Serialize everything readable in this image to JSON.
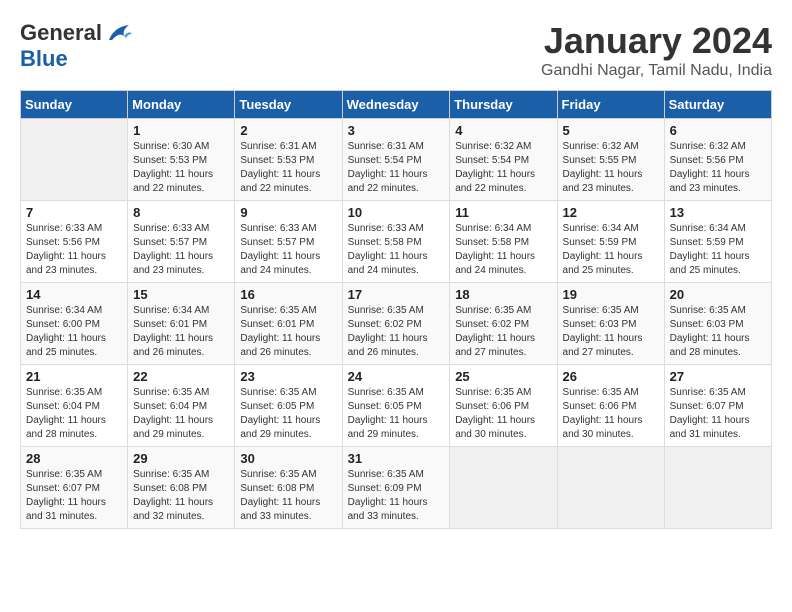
{
  "header": {
    "logo_general": "General",
    "logo_blue": "Blue",
    "title": "January 2024",
    "subtitle": "Gandhi Nagar, Tamil Nadu, India"
  },
  "calendar": {
    "days_of_week": [
      "Sunday",
      "Monday",
      "Tuesday",
      "Wednesday",
      "Thursday",
      "Friday",
      "Saturday"
    ],
    "weeks": [
      [
        {
          "day": "",
          "sunrise": "",
          "sunset": "",
          "daylight": ""
        },
        {
          "day": "1",
          "sunrise": "Sunrise: 6:30 AM",
          "sunset": "Sunset: 5:53 PM",
          "daylight": "Daylight: 11 hours and 22 minutes."
        },
        {
          "day": "2",
          "sunrise": "Sunrise: 6:31 AM",
          "sunset": "Sunset: 5:53 PM",
          "daylight": "Daylight: 11 hours and 22 minutes."
        },
        {
          "day": "3",
          "sunrise": "Sunrise: 6:31 AM",
          "sunset": "Sunset: 5:54 PM",
          "daylight": "Daylight: 11 hours and 22 minutes."
        },
        {
          "day": "4",
          "sunrise": "Sunrise: 6:32 AM",
          "sunset": "Sunset: 5:54 PM",
          "daylight": "Daylight: 11 hours and 22 minutes."
        },
        {
          "day": "5",
          "sunrise": "Sunrise: 6:32 AM",
          "sunset": "Sunset: 5:55 PM",
          "daylight": "Daylight: 11 hours and 23 minutes."
        },
        {
          "day": "6",
          "sunrise": "Sunrise: 6:32 AM",
          "sunset": "Sunset: 5:56 PM",
          "daylight": "Daylight: 11 hours and 23 minutes."
        }
      ],
      [
        {
          "day": "7",
          "sunrise": "Sunrise: 6:33 AM",
          "sunset": "Sunset: 5:56 PM",
          "daylight": "Daylight: 11 hours and 23 minutes."
        },
        {
          "day": "8",
          "sunrise": "Sunrise: 6:33 AM",
          "sunset": "Sunset: 5:57 PM",
          "daylight": "Daylight: 11 hours and 23 minutes."
        },
        {
          "day": "9",
          "sunrise": "Sunrise: 6:33 AM",
          "sunset": "Sunset: 5:57 PM",
          "daylight": "Daylight: 11 hours and 24 minutes."
        },
        {
          "day": "10",
          "sunrise": "Sunrise: 6:33 AM",
          "sunset": "Sunset: 5:58 PM",
          "daylight": "Daylight: 11 hours and 24 minutes."
        },
        {
          "day": "11",
          "sunrise": "Sunrise: 6:34 AM",
          "sunset": "Sunset: 5:58 PM",
          "daylight": "Daylight: 11 hours and 24 minutes."
        },
        {
          "day": "12",
          "sunrise": "Sunrise: 6:34 AM",
          "sunset": "Sunset: 5:59 PM",
          "daylight": "Daylight: 11 hours and 25 minutes."
        },
        {
          "day": "13",
          "sunrise": "Sunrise: 6:34 AM",
          "sunset": "Sunset: 5:59 PM",
          "daylight": "Daylight: 11 hours and 25 minutes."
        }
      ],
      [
        {
          "day": "14",
          "sunrise": "Sunrise: 6:34 AM",
          "sunset": "Sunset: 6:00 PM",
          "daylight": "Daylight: 11 hours and 25 minutes."
        },
        {
          "day": "15",
          "sunrise": "Sunrise: 6:34 AM",
          "sunset": "Sunset: 6:01 PM",
          "daylight": "Daylight: 11 hours and 26 minutes."
        },
        {
          "day": "16",
          "sunrise": "Sunrise: 6:35 AM",
          "sunset": "Sunset: 6:01 PM",
          "daylight": "Daylight: 11 hours and 26 minutes."
        },
        {
          "day": "17",
          "sunrise": "Sunrise: 6:35 AM",
          "sunset": "Sunset: 6:02 PM",
          "daylight": "Daylight: 11 hours and 26 minutes."
        },
        {
          "day": "18",
          "sunrise": "Sunrise: 6:35 AM",
          "sunset": "Sunset: 6:02 PM",
          "daylight": "Daylight: 11 hours and 27 minutes."
        },
        {
          "day": "19",
          "sunrise": "Sunrise: 6:35 AM",
          "sunset": "Sunset: 6:03 PM",
          "daylight": "Daylight: 11 hours and 27 minutes."
        },
        {
          "day": "20",
          "sunrise": "Sunrise: 6:35 AM",
          "sunset": "Sunset: 6:03 PM",
          "daylight": "Daylight: 11 hours and 28 minutes."
        }
      ],
      [
        {
          "day": "21",
          "sunrise": "Sunrise: 6:35 AM",
          "sunset": "Sunset: 6:04 PM",
          "daylight": "Daylight: 11 hours and 28 minutes."
        },
        {
          "day": "22",
          "sunrise": "Sunrise: 6:35 AM",
          "sunset": "Sunset: 6:04 PM",
          "daylight": "Daylight: 11 hours and 29 minutes."
        },
        {
          "day": "23",
          "sunrise": "Sunrise: 6:35 AM",
          "sunset": "Sunset: 6:05 PM",
          "daylight": "Daylight: 11 hours and 29 minutes."
        },
        {
          "day": "24",
          "sunrise": "Sunrise: 6:35 AM",
          "sunset": "Sunset: 6:05 PM",
          "daylight": "Daylight: 11 hours and 29 minutes."
        },
        {
          "day": "25",
          "sunrise": "Sunrise: 6:35 AM",
          "sunset": "Sunset: 6:06 PM",
          "daylight": "Daylight: 11 hours and 30 minutes."
        },
        {
          "day": "26",
          "sunrise": "Sunrise: 6:35 AM",
          "sunset": "Sunset: 6:06 PM",
          "daylight": "Daylight: 11 hours and 30 minutes."
        },
        {
          "day": "27",
          "sunrise": "Sunrise: 6:35 AM",
          "sunset": "Sunset: 6:07 PM",
          "daylight": "Daylight: 11 hours and 31 minutes."
        }
      ],
      [
        {
          "day": "28",
          "sunrise": "Sunrise: 6:35 AM",
          "sunset": "Sunset: 6:07 PM",
          "daylight": "Daylight: 11 hours and 31 minutes."
        },
        {
          "day": "29",
          "sunrise": "Sunrise: 6:35 AM",
          "sunset": "Sunset: 6:08 PM",
          "daylight": "Daylight: 11 hours and 32 minutes."
        },
        {
          "day": "30",
          "sunrise": "Sunrise: 6:35 AM",
          "sunset": "Sunset: 6:08 PM",
          "daylight": "Daylight: 11 hours and 33 minutes."
        },
        {
          "day": "31",
          "sunrise": "Sunrise: 6:35 AM",
          "sunset": "Sunset: 6:09 PM",
          "daylight": "Daylight: 11 hours and 33 minutes."
        },
        {
          "day": "",
          "sunrise": "",
          "sunset": "",
          "daylight": ""
        },
        {
          "day": "",
          "sunrise": "",
          "sunset": "",
          "daylight": ""
        },
        {
          "day": "",
          "sunrise": "",
          "sunset": "",
          "daylight": ""
        }
      ]
    ]
  }
}
